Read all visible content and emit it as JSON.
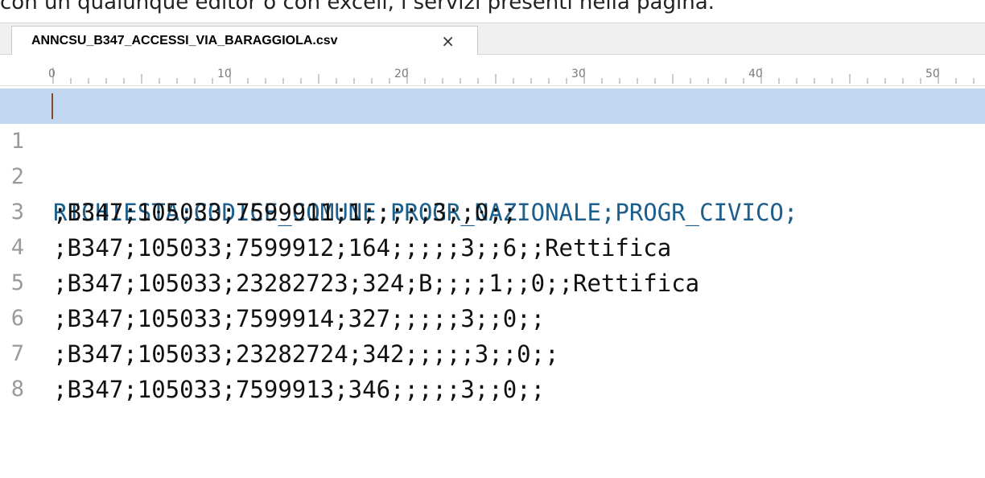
{
  "context_text": "con un qualunque editor o con excell, i servizi presenti nella pagina.",
  "tab": {
    "title": "ANNCSU_B347_ACCESSI_VIA_BARAGGIOLA.csv",
    "close_label": "×"
  },
  "ruler": {
    "labels": [
      "0",
      "10",
      "20",
      "30",
      "40",
      "50"
    ]
  },
  "editor": {
    "lines": [
      {
        "num": "1",
        "text": "RICHIESTA;CODICE_COMUNE;PROGR_NAZIONALE;PROGR_CIVICO;",
        "selected": true
      },
      {
        "num": "2",
        "text": ";B347;105033;7599911;1;;;;;3;;0;;"
      },
      {
        "num": "3",
        "text": ";B347;105033;7599912;164;;;;;3;;6;;Rettifica"
      },
      {
        "num": "4",
        "text": ";B347;105033;23282723;324;B;;;;1;;0;;Rettifica"
      },
      {
        "num": "5",
        "text": ";B347;105033;7599914;327;;;;;3;;0;;"
      },
      {
        "num": "6",
        "text": ";B347;105033;23282724;342;;;;;3;;0;;"
      },
      {
        "num": "7",
        "text": ";B347;105033;7599913;346;;;;;3;;0;;"
      },
      {
        "num": "8",
        "text": ""
      }
    ]
  }
}
